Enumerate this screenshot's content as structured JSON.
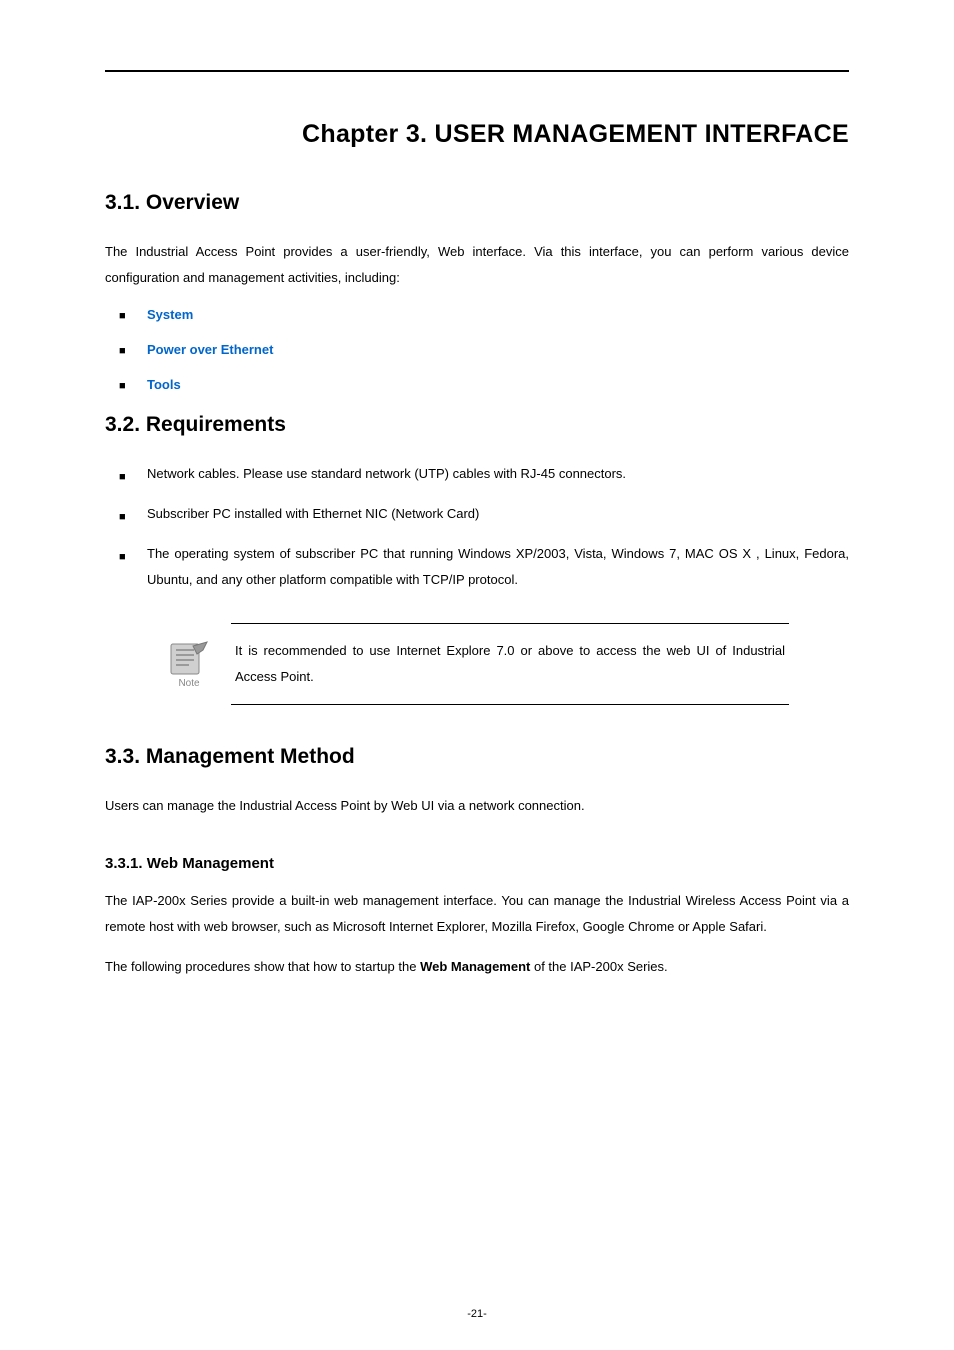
{
  "chapter": {
    "prefix": "Chapter 3.",
    "title": "USER MANAGEMENT INTERFACE"
  },
  "section_overview": {
    "heading": "3.1.  Overview",
    "intro": "The Industrial Access Point provides a user-friendly, Web interface. Via this interface, you can perform various device configuration and management activities, including:",
    "links": [
      "System",
      "Power over Ethernet",
      "Tools"
    ]
  },
  "section_requirements": {
    "heading": "3.2.  Requirements",
    "items": [
      "Network cables. Please use standard network (UTP) cables with RJ-45 connectors.",
      "Subscriber PC installed with Ethernet NIC (Network Card)",
      "The operating system of subscriber PC that running Windows XP/2003, Vista, Windows 7, MAC OS X , Linux, Fedora, Ubuntu, and any other platform compatible with TCP/IP protocol."
    ]
  },
  "note": {
    "label": "Note",
    "text": "It is recommended to use Internet Explore 7.0 or above to access the web UI of Industrial Access Point."
  },
  "section_mgmt": {
    "heading": "3.3.  Management Method",
    "intro": "Users can manage the Industrial Access Point by Web UI via a network connection."
  },
  "subsection_web": {
    "heading": "3.3.1.  Web Management",
    "para1": "The IAP-200x Series provide a built-in web management interface. You can manage the Industrial Wireless Access Point via a remote host with web browser, such as Microsoft Internet Explorer, Mozilla Firefox, Google Chrome or Apple Safari.",
    "para2_pre": "The following procedures show that how to startup the ",
    "para2_bold": "Web Management",
    "para2_post": " of the IAP-200x Series."
  },
  "page_number": "-21-"
}
